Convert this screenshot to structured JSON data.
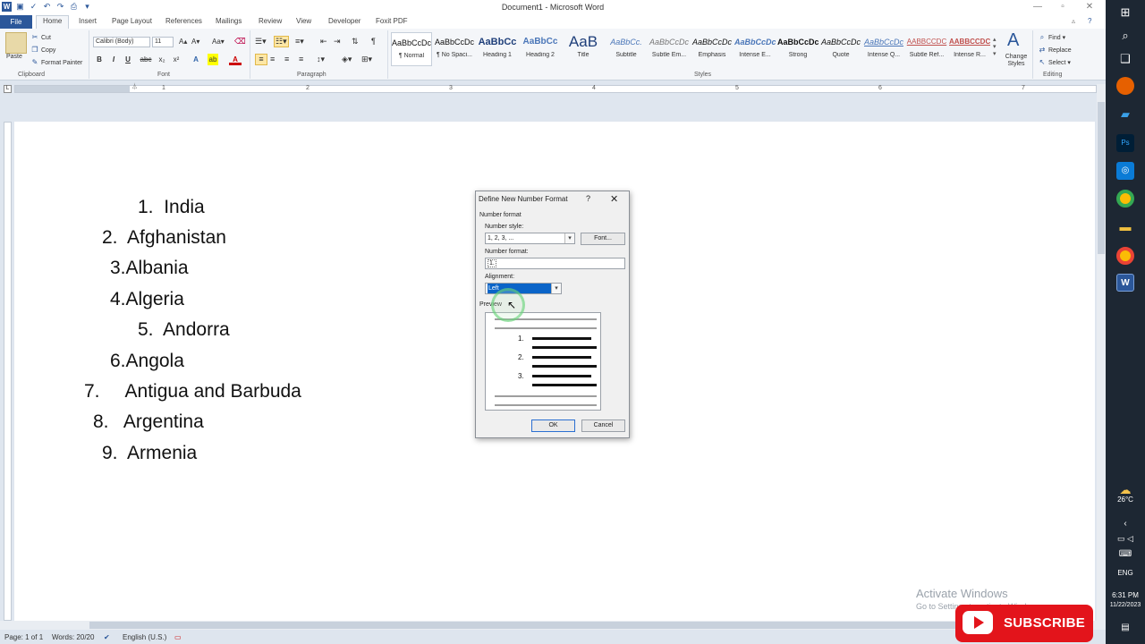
{
  "window": {
    "title": "Document1 - Microsoft Word",
    "logo_letter": "W"
  },
  "tabs": [
    "File",
    "Home",
    "Insert",
    "Page Layout",
    "References",
    "Mailings",
    "Review",
    "View",
    "Developer",
    "Foxit PDF"
  ],
  "ribbon": {
    "clipboard": {
      "label": "Clipboard",
      "paste": "Paste",
      "cut": "Cut",
      "copy": "Copy",
      "format_painter": "Format Painter"
    },
    "font": {
      "label": "Font",
      "name": "Calibri (Body)",
      "size": "11"
    },
    "paragraph": {
      "label": "Paragraph"
    },
    "styles": {
      "label": "Styles",
      "items": [
        {
          "preview": "AaBbCcDc",
          "name": "¶ Normal"
        },
        {
          "preview": "AaBbCcDc",
          "name": "¶ No Spaci..."
        },
        {
          "preview": "AaBbCc",
          "name": "Heading 1"
        },
        {
          "preview": "AaBbCc",
          "name": "Heading 2"
        },
        {
          "preview": "AaB",
          "name": "Title"
        },
        {
          "preview": "AaBbCc.",
          "name": "Subtitle"
        },
        {
          "preview": "AaBbCcDc",
          "name": "Subtle Em..."
        },
        {
          "preview": "AaBbCcDc",
          "name": "Emphasis"
        },
        {
          "preview": "AaBbCcDc",
          "name": "Intense E..."
        },
        {
          "preview": "AaBbCcDc",
          "name": "Strong"
        },
        {
          "preview": "AaBbCcDc",
          "name": "Quote"
        },
        {
          "preview": "AaBbCcDc",
          "name": "Intense Q..."
        },
        {
          "preview": "AABBCCDC",
          "name": "Subtle Ref..."
        },
        {
          "preview": "AABBCCDC",
          "name": "Intense R..."
        }
      ],
      "change_styles": "Change Styles"
    },
    "editing": {
      "label": "Editing",
      "find": "Find",
      "replace": "Replace",
      "select": "Select"
    }
  },
  "ruler_numbers": [
    "1",
    "2",
    "3",
    "4",
    "5",
    "6",
    "7"
  ],
  "document": {
    "list": [
      {
        "num": "1.",
        "text": "India"
      },
      {
        "num": "2.",
        "text": "Afghanistan"
      },
      {
        "num": "3.",
        "text": "Albania"
      },
      {
        "num": "4.",
        "text": "Algeria"
      },
      {
        "num": "5.",
        "text": "Andorra"
      },
      {
        "num": "6.",
        "text": "Angola"
      },
      {
        "num": "7.",
        "text": "Antigua and Barbuda"
      },
      {
        "num": "8.",
        "text": "Argentina"
      },
      {
        "num": "9.",
        "text": "Armenia"
      }
    ]
  },
  "dialog": {
    "title": "Define New Number Format",
    "help": "?",
    "close": "✕",
    "section": "Number format",
    "number_style_label": "Number style:",
    "number_style_value": "1, 2, 3, ...",
    "font_button": "Font...",
    "number_format_label": "Number format:",
    "number_format_value": "1.",
    "alignment_label": "Alignment:",
    "alignment_value": "Left",
    "preview_label": "Preview",
    "preview_numbers": [
      "1.",
      "2.",
      "3."
    ],
    "ok": "OK",
    "cancel": "Cancel"
  },
  "statusbar": {
    "page": "Page: 1 of 1",
    "words": "Words: 20/20",
    "language": "English (U.S.)"
  },
  "watermark": {
    "line1": "Activate Windows",
    "line2": "Go to Settings to activate Windows."
  },
  "subscribe": "SUBSCRIBE",
  "taskbar": {
    "weather": "26°C",
    "lang": "ENG",
    "time": "6:31 PM",
    "date": "11/22/2023"
  },
  "colors": {
    "accent": "#2b579a",
    "subscribe_red": "#e3141b"
  }
}
